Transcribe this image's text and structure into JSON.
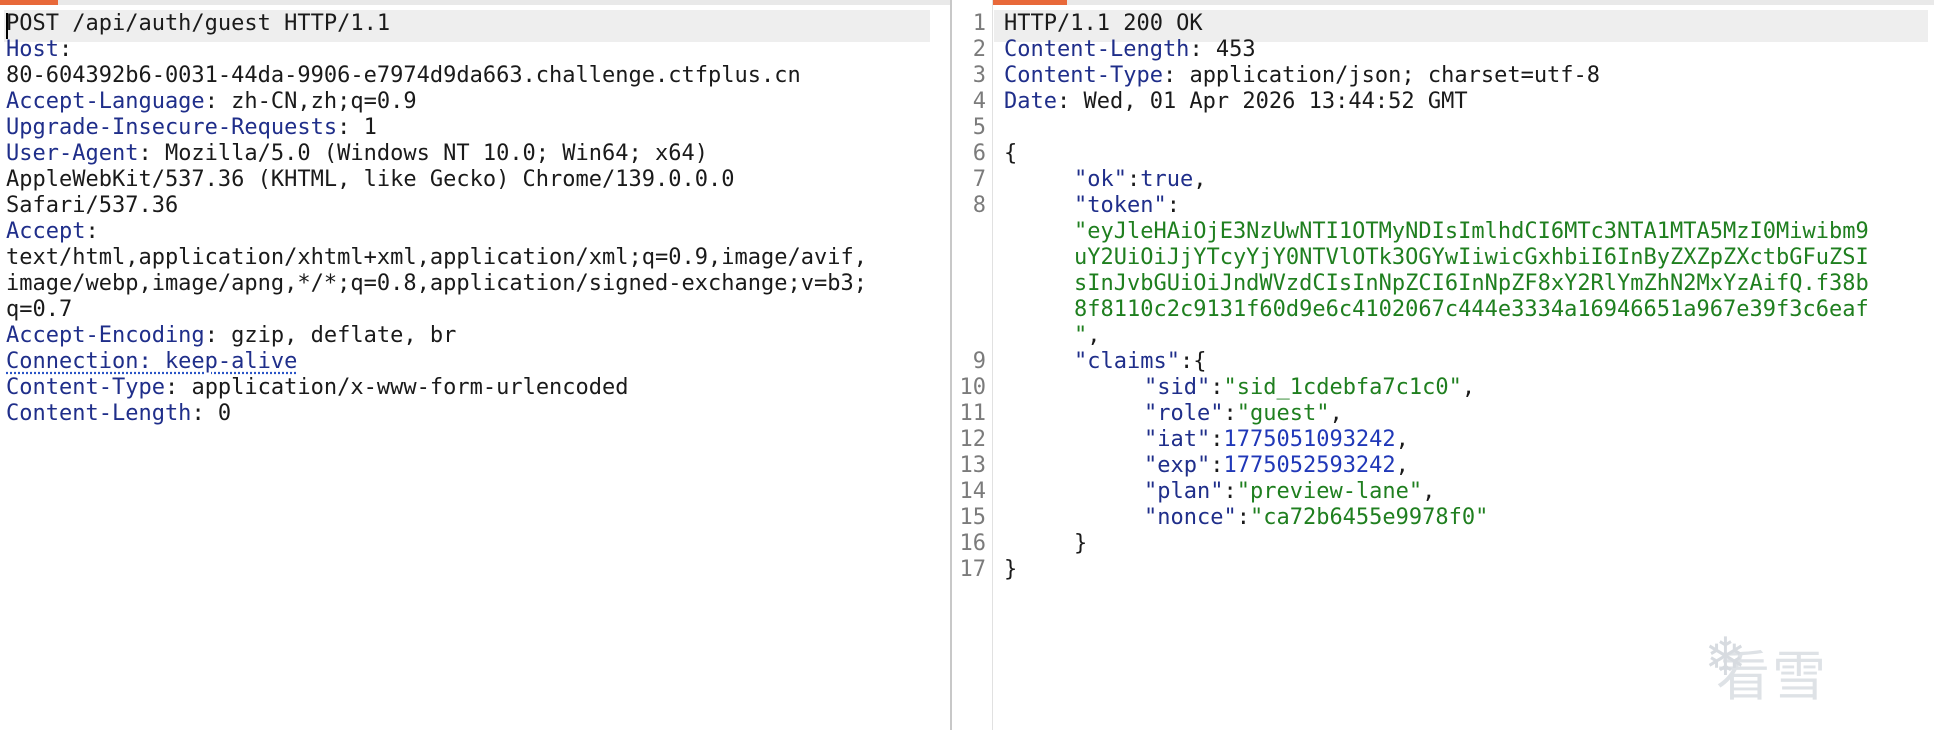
{
  "request": {
    "lines": [
      {
        "parts": [
          {
            "t": "POST /api/auth/guest HTTP/1.1",
            "c": "plain"
          }
        ]
      },
      {
        "parts": [
          {
            "t": "Host",
            "c": "k"
          },
          {
            "t": ":",
            "c": "plain"
          }
        ]
      },
      {
        "parts": [
          {
            "t": "80-604392b6-0031-44da-9906-e7974d9da663.challenge.ctfplus.cn",
            "c": "plain"
          }
        ]
      },
      {
        "parts": [
          {
            "t": "Accept-Language",
            "c": "k"
          },
          {
            "t": ": zh-CN,zh;q=0.9",
            "c": "plain"
          }
        ]
      },
      {
        "parts": [
          {
            "t": "Upgrade-Insecure-Requests",
            "c": "k"
          },
          {
            "t": ": 1",
            "c": "plain"
          }
        ]
      },
      {
        "parts": [
          {
            "t": "User-Agent",
            "c": "k"
          },
          {
            "t": ": Mozilla/5.0 (Windows NT 10.0; Win64; x64)",
            "c": "plain"
          }
        ]
      },
      {
        "parts": [
          {
            "t": "AppleWebKit/537.36 (KHTML, like Gecko) Chrome/139.0.0.0",
            "c": "plain"
          }
        ]
      },
      {
        "parts": [
          {
            "t": "Safari/537.36",
            "c": "plain"
          }
        ]
      },
      {
        "parts": [
          {
            "t": "Accept",
            "c": "k"
          },
          {
            "t": ":",
            "c": "plain"
          }
        ]
      },
      {
        "parts": [
          {
            "t": "text/html,application/xhtml+xml,application/xml;q=0.9,image/avif,",
            "c": "plain"
          }
        ]
      },
      {
        "parts": [
          {
            "t": "image/webp,image/apng,*/*;q=0.8,application/signed-exchange;v=b3;",
            "c": "plain"
          }
        ]
      },
      {
        "parts": [
          {
            "t": "q=0.7",
            "c": "plain"
          }
        ]
      },
      {
        "parts": [
          {
            "t": "Accept-Encoding",
            "c": "k"
          },
          {
            "t": ": gzip, deflate, br",
            "c": "plain"
          }
        ]
      },
      {
        "parts": [
          {
            "t": "Connection: keep-alive",
            "c": "k wavy"
          }
        ]
      },
      {
        "parts": [
          {
            "t": "Content-Type",
            "c": "k"
          },
          {
            "t": ": application/x-www-form-urlencoded",
            "c": "plain"
          }
        ]
      },
      {
        "parts": [
          {
            "t": "Content-Length",
            "c": "k"
          },
          {
            "t": ": 0",
            "c": "plain"
          }
        ]
      }
    ]
  },
  "response": {
    "line_numbers": [
      "1",
      "2",
      "3",
      "4",
      "5",
      "6",
      "7",
      "8",
      "9",
      "10",
      "11",
      "12",
      "13",
      "14",
      "15",
      "16",
      "17"
    ],
    "lines": [
      {
        "row": 0,
        "indent": 0,
        "parts": [
          {
            "t": "HTTP/1.1 200 OK",
            "c": "plain"
          }
        ]
      },
      {
        "row": 1,
        "indent": 0,
        "parts": [
          {
            "t": "Content-Length",
            "c": "k"
          },
          {
            "t": ": 453",
            "c": "plain"
          }
        ]
      },
      {
        "row": 2,
        "indent": 0,
        "parts": [
          {
            "t": "Content-Type",
            "c": "k"
          },
          {
            "t": ": application/json; charset=utf-8",
            "c": "plain"
          }
        ]
      },
      {
        "row": 3,
        "indent": 0,
        "parts": [
          {
            "t": "Date",
            "c": "k"
          },
          {
            "t": ": Wed, 01 Apr 2026 13:44:52 GMT",
            "c": "plain"
          }
        ]
      },
      {
        "row": 4,
        "indent": 0,
        "parts": [
          {
            "t": "",
            "c": "plain"
          }
        ]
      },
      {
        "row": 5,
        "indent": 0,
        "parts": [
          {
            "t": "{",
            "c": "plain"
          }
        ]
      },
      {
        "row": 6,
        "indent": 1,
        "parts": [
          {
            "t": "\"ok\"",
            "c": "k"
          },
          {
            "t": ":",
            "c": "plain"
          },
          {
            "t": "true",
            "c": "k"
          },
          {
            "t": ",",
            "c": "plain"
          }
        ]
      },
      {
        "row": 7,
        "indent": 1,
        "parts": [
          {
            "t": "\"token\"",
            "c": "k"
          },
          {
            "t": ":",
            "c": "plain"
          }
        ]
      },
      {
        "row": 8,
        "indent": 1,
        "parts": [
          {
            "t": "\"eyJleHAiOjE3NzUwNTI1OTMyNDIsImlhdCI6MTc3NTA1MTA5MzI0Miwibm9",
            "c": "str"
          }
        ]
      },
      {
        "row": 9,
        "indent": 1,
        "parts": [
          {
            "t": "uY2UiOiJjYTcyYjY0NTVlOTk3OGYwIiwicGxhbiI6InByZXZpZXctbGFuZSI",
            "c": "str"
          }
        ]
      },
      {
        "row": 10,
        "indent": 1,
        "parts": [
          {
            "t": "sInJvbGUiOiJndWVzdCIsInNpZCI6InNpZF8xY2RlYmZhN2MxYzAifQ.f38b",
            "c": "str"
          }
        ]
      },
      {
        "row": 11,
        "indent": 1,
        "parts": [
          {
            "t": "8f8110c2c9131f60d9e6c4102067c444e3334a16946651a967e39f3c6eaf",
            "c": "str"
          }
        ]
      },
      {
        "row": 12,
        "indent": 1,
        "parts": [
          {
            "t": "\"",
            "c": "str"
          },
          {
            "t": ",",
            "c": "plain"
          }
        ]
      },
      {
        "row": 13,
        "indent": 1,
        "parts": [
          {
            "t": "\"claims\"",
            "c": "k"
          },
          {
            "t": ":{",
            "c": "plain"
          }
        ]
      },
      {
        "row": 14,
        "indent": 2,
        "parts": [
          {
            "t": "\"sid\"",
            "c": "k"
          },
          {
            "t": ":",
            "c": "plain"
          },
          {
            "t": "\"sid_1cdebfa7c1c0\"",
            "c": "str"
          },
          {
            "t": ",",
            "c": "plain"
          }
        ]
      },
      {
        "row": 15,
        "indent": 2,
        "parts": [
          {
            "t": "\"role\"",
            "c": "k"
          },
          {
            "t": ":",
            "c": "plain"
          },
          {
            "t": "\"guest\"",
            "c": "str"
          },
          {
            "t": ",",
            "c": "plain"
          }
        ]
      },
      {
        "row": 16,
        "indent": 2,
        "parts": [
          {
            "t": "\"iat\"",
            "c": "k"
          },
          {
            "t": ":",
            "c": "plain"
          },
          {
            "t": "1775051093242",
            "c": "num"
          },
          {
            "t": ",",
            "c": "plain"
          }
        ]
      },
      {
        "row": 17,
        "indent": 2,
        "parts": [
          {
            "t": "\"exp\"",
            "c": "k"
          },
          {
            "t": ":",
            "c": "plain"
          },
          {
            "t": "1775052593242",
            "c": "num"
          },
          {
            "t": ",",
            "c": "plain"
          }
        ]
      },
      {
        "row": 18,
        "indent": 2,
        "parts": [
          {
            "t": "\"plan\"",
            "c": "k"
          },
          {
            "t": ":",
            "c": "plain"
          },
          {
            "t": "\"preview-lane\"",
            "c": "str"
          },
          {
            "t": ",",
            "c": "plain"
          }
        ]
      },
      {
        "row": 19,
        "indent": 2,
        "parts": [
          {
            "t": "\"nonce\"",
            "c": "k"
          },
          {
            "t": ":",
            "c": "plain"
          },
          {
            "t": "\"ca72b6455e9978f0\"",
            "c": "str"
          }
        ]
      },
      {
        "row": 20,
        "indent": 1,
        "parts": [
          {
            "t": "}",
            "c": "plain"
          }
        ]
      },
      {
        "row": 21,
        "indent": 0,
        "parts": [
          {
            "t": "}",
            "c": "plain"
          }
        ]
      }
    ],
    "gutter_rows": [
      0,
      1,
      2,
      3,
      4,
      5,
      6,
      7,
      13,
      14,
      15,
      16,
      17,
      18,
      19,
      20,
      21
    ]
  },
  "watermark": {
    "text": "看雪",
    "icon": "snowflake-icon"
  },
  "colors": {
    "header_key": "#1f2e8a",
    "string": "#1f7f1f",
    "number": "#2038b8",
    "accent": "#e8693a"
  }
}
